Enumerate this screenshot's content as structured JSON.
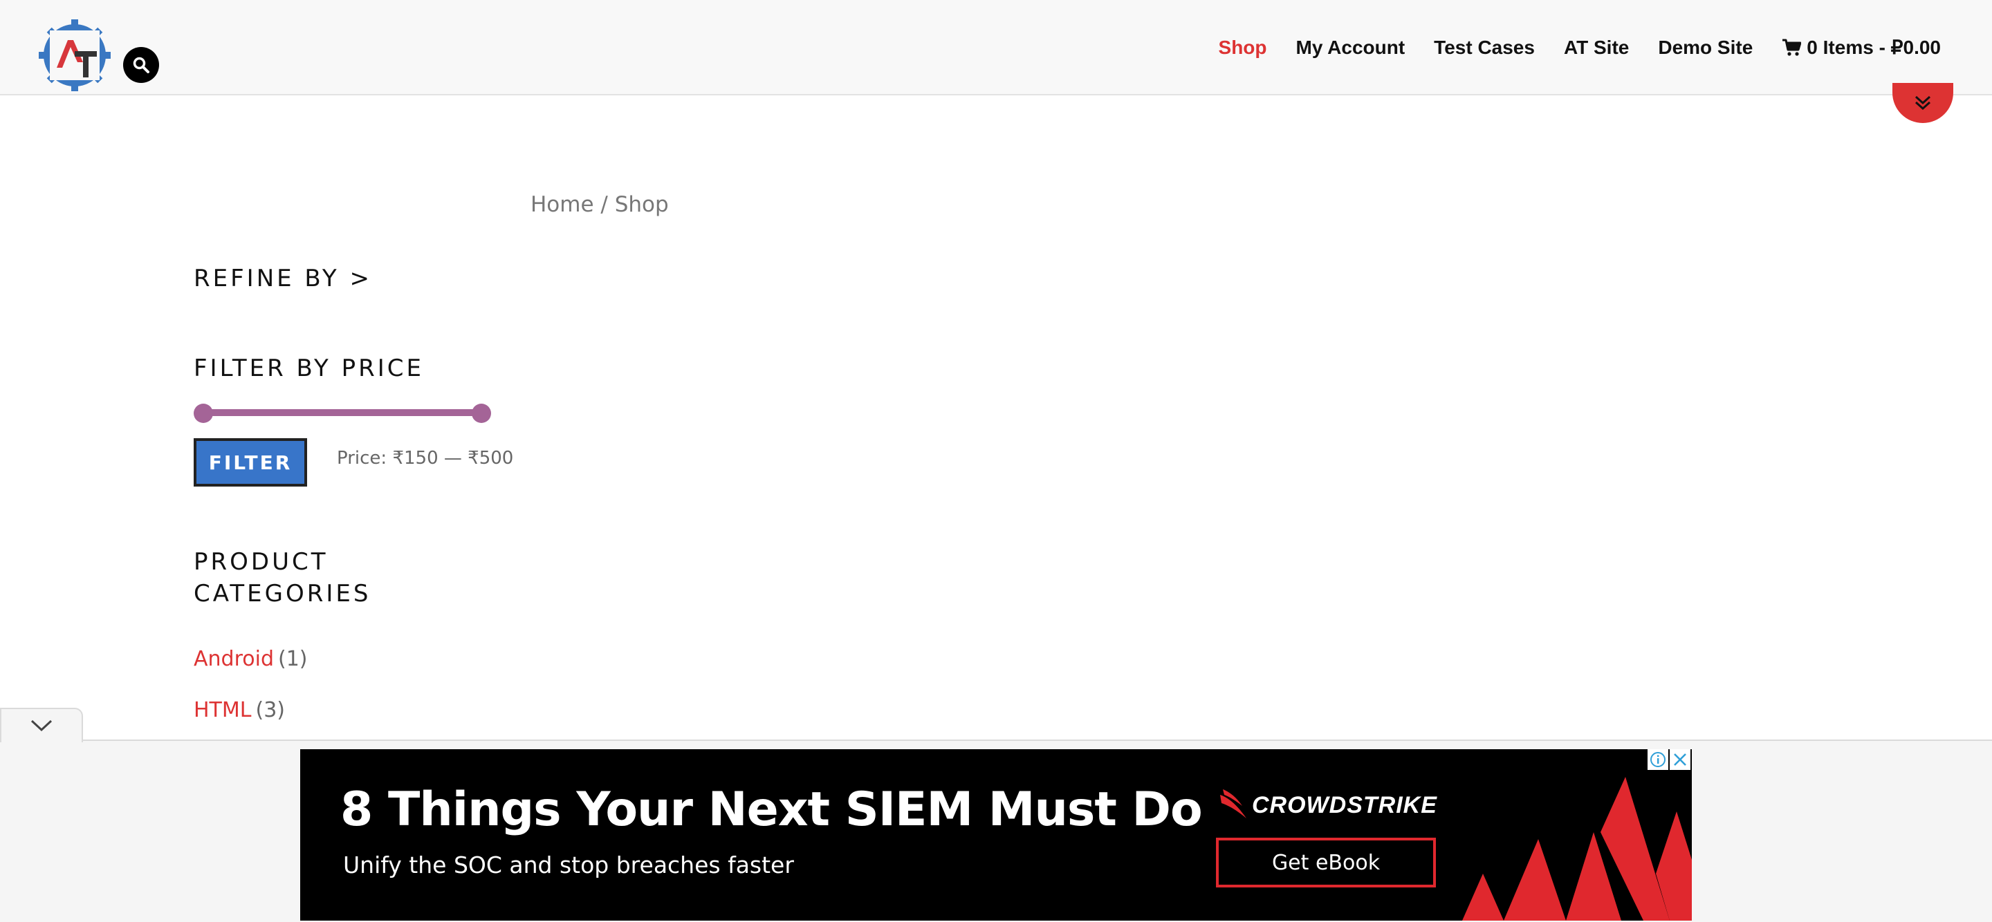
{
  "header": {
    "logo_name": "at-logo",
    "nav": [
      {
        "label": "Shop",
        "active": true
      },
      {
        "label": "My Account",
        "active": false
      },
      {
        "label": "Test Cases",
        "active": false
      },
      {
        "label": "AT Site",
        "active": false
      },
      {
        "label": "Demo Site",
        "active": false
      }
    ],
    "cart": {
      "label": "0 Items - ₽0.00",
      "icon": "cart-icon"
    }
  },
  "breadcrumb": "Home / Shop",
  "sidebar": {
    "refine_title": "REFINE BY >",
    "price_filter": {
      "title": "FILTER BY PRICE",
      "button_label": "FILTER",
      "price_text": "Price: ₹150 — ₹500",
      "min": 150,
      "max": 500
    },
    "categories": {
      "title": "PRODUCT CATEGORIES",
      "items": [
        {
          "name": "Android",
          "count": "(1)"
        },
        {
          "name": "HTML",
          "count": "(3)"
        }
      ]
    }
  },
  "ad": {
    "headline": "8 Things Your Next SIEM Must Do",
    "subline": "Unify the SOC and stop breaches faster",
    "brand": "CROWDSTRIKE",
    "cta": "Get eBook"
  },
  "colors": {
    "accent": "#dd3333",
    "filter_button": "#3875c9",
    "slider": "#a46497",
    "ad_red": "#e0282e"
  }
}
